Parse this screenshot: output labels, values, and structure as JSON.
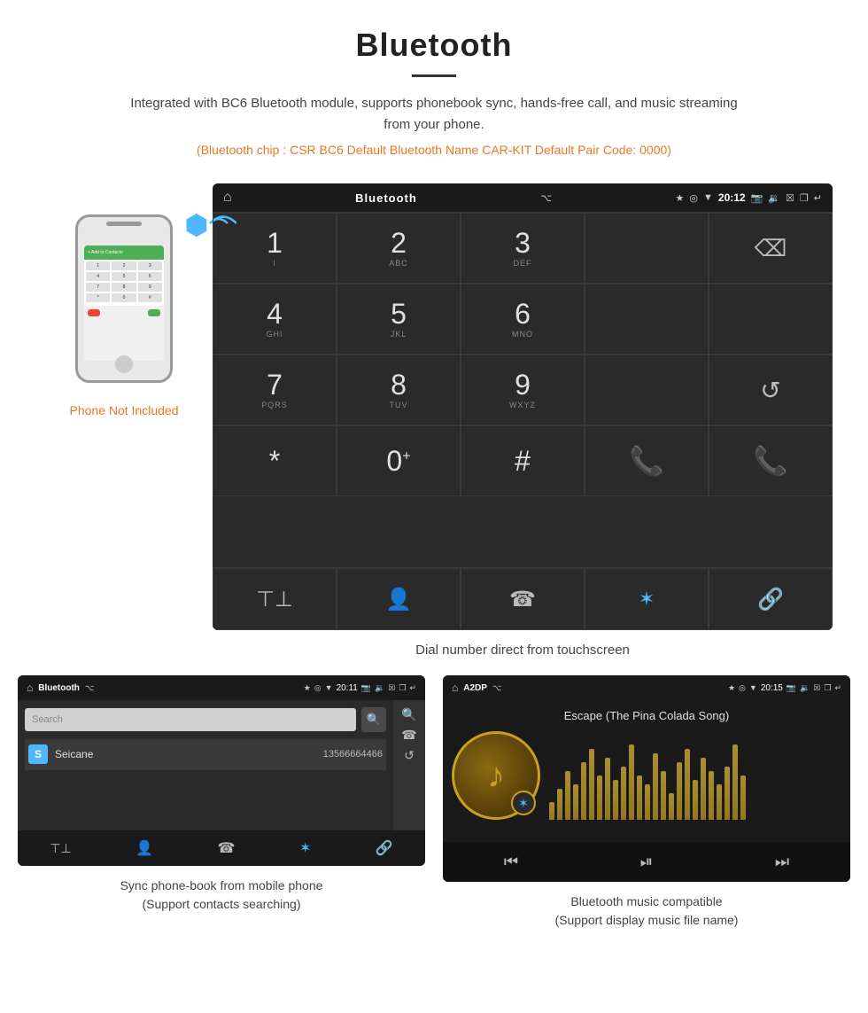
{
  "page": {
    "title": "Bluetooth",
    "divider": true,
    "description": "Integrated with BC6 Bluetooth module, supports phonebook sync, hands-free call, and music streaming from your phone.",
    "specs": "(Bluetooth chip : CSR BC6    Default Bluetooth Name CAR-KIT    Default Pair Code: 0000)"
  },
  "phone_label": {
    "not": "Phone Not",
    "included": " Included"
  },
  "dial_screen": {
    "status_label": "Bluetooth",
    "time": "20:12",
    "caption": "Dial number direct from touchscreen",
    "keys": [
      {
        "main": "1",
        "sub": "⌁"
      },
      {
        "main": "2",
        "sub": "ABC"
      },
      {
        "main": "3",
        "sub": "DEF"
      },
      {
        "main": "",
        "sub": ""
      },
      {
        "main": "⌫",
        "sub": ""
      }
    ],
    "keys2": [
      {
        "main": "4",
        "sub": "GHI"
      },
      {
        "main": "5",
        "sub": "JKL"
      },
      {
        "main": "6",
        "sub": "MNO"
      },
      {
        "main": "",
        "sub": ""
      },
      {
        "main": "",
        "sub": ""
      }
    ],
    "keys3": [
      {
        "main": "7",
        "sub": "PQRS"
      },
      {
        "main": "8",
        "sub": "TUV"
      },
      {
        "main": "9",
        "sub": "WXYZ"
      },
      {
        "main": "",
        "sub": ""
      },
      {
        "main": "↻",
        "sub": ""
      }
    ],
    "keys4": [
      {
        "main": "*",
        "sub": ""
      },
      {
        "main": "0",
        "sub": "+"
      },
      {
        "main": "#",
        "sub": ""
      },
      {
        "main": "📞",
        "sub": ""
      },
      {
        "main": "📵",
        "sub": ""
      }
    ],
    "bottom_icons": [
      "⊞",
      "👤",
      "📞",
      "✦",
      "🔗"
    ]
  },
  "phonebook_screen": {
    "status_label": "Bluetooth",
    "time": "20:11",
    "search_placeholder": "Search",
    "contact_letter": "S",
    "contact_name": "Seicane",
    "contact_number": "13566664466",
    "caption_line1": "Sync phone-book from mobile phone",
    "caption_line2": "(Support contacts searching)"
  },
  "music_screen": {
    "status_label": "A2DP",
    "time": "20:15",
    "song_title": "Escape (The Pina Colada Song)",
    "visualizer_bars": [
      20,
      35,
      55,
      40,
      65,
      80,
      50,
      70,
      45,
      60,
      85,
      50,
      40,
      75,
      55,
      30,
      65,
      80,
      45,
      70,
      55,
      40,
      60,
      85,
      50
    ],
    "caption_line1": "Bluetooth music compatible",
    "caption_line2": "(Support display music file name)"
  }
}
